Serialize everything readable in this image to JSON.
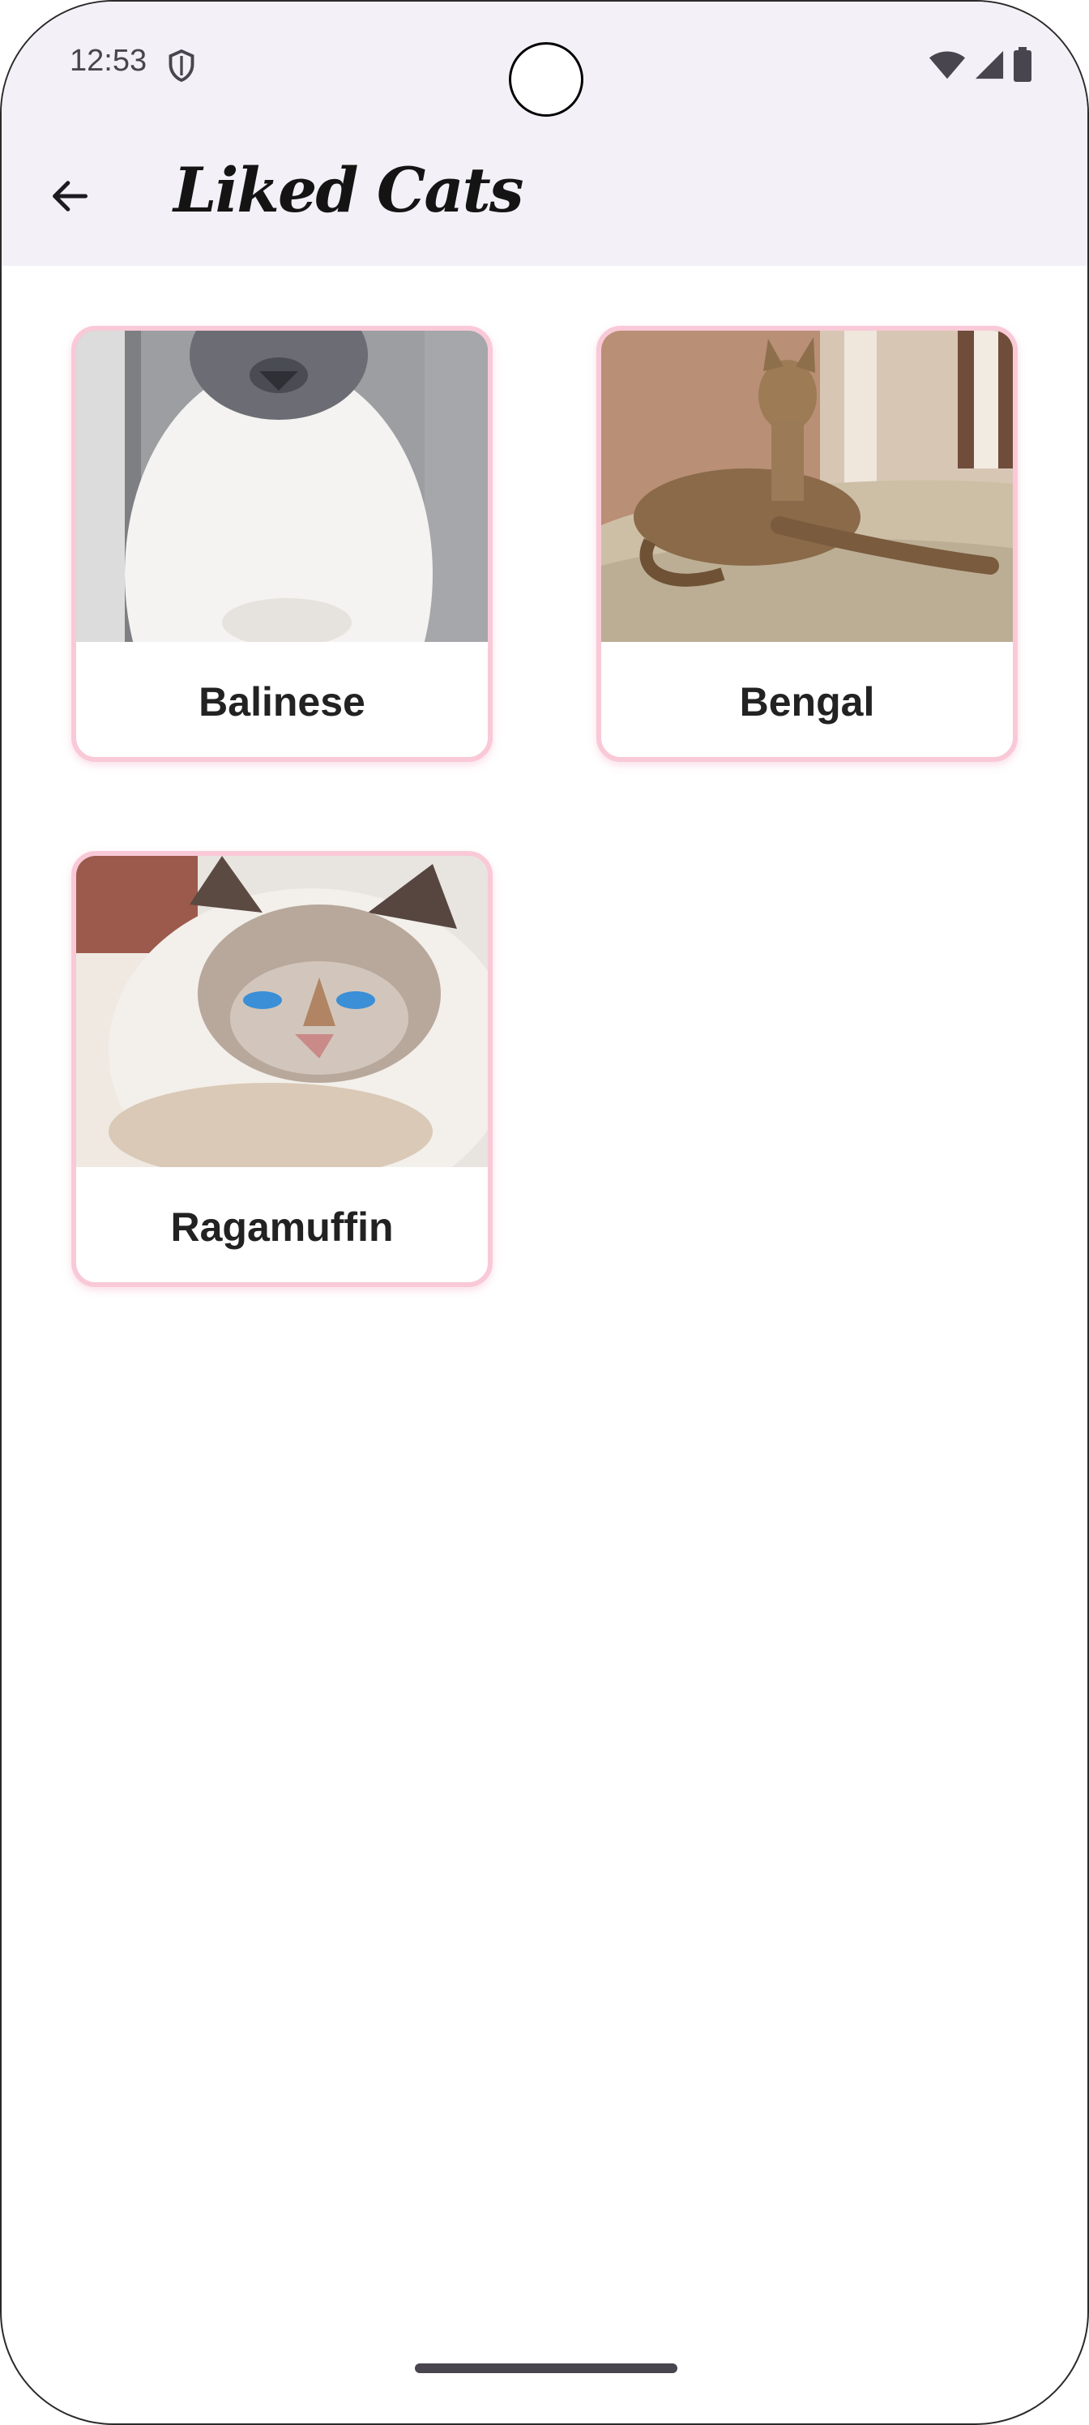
{
  "status_bar": {
    "time": "12:53",
    "icons": [
      "shield-icon",
      "wifi-icon",
      "signal-icon",
      "battery-icon"
    ]
  },
  "app_bar": {
    "back_icon": "arrow-back-icon",
    "title": "Liked Cats"
  },
  "cats": [
    {
      "name": "Balinese"
    },
    {
      "name": "Bengal"
    },
    {
      "name": "Ragamuffin"
    }
  ],
  "colors": {
    "app_bar_bg": "#f3f0f7",
    "card_border": "#f9c9d7",
    "text": "#222222"
  }
}
